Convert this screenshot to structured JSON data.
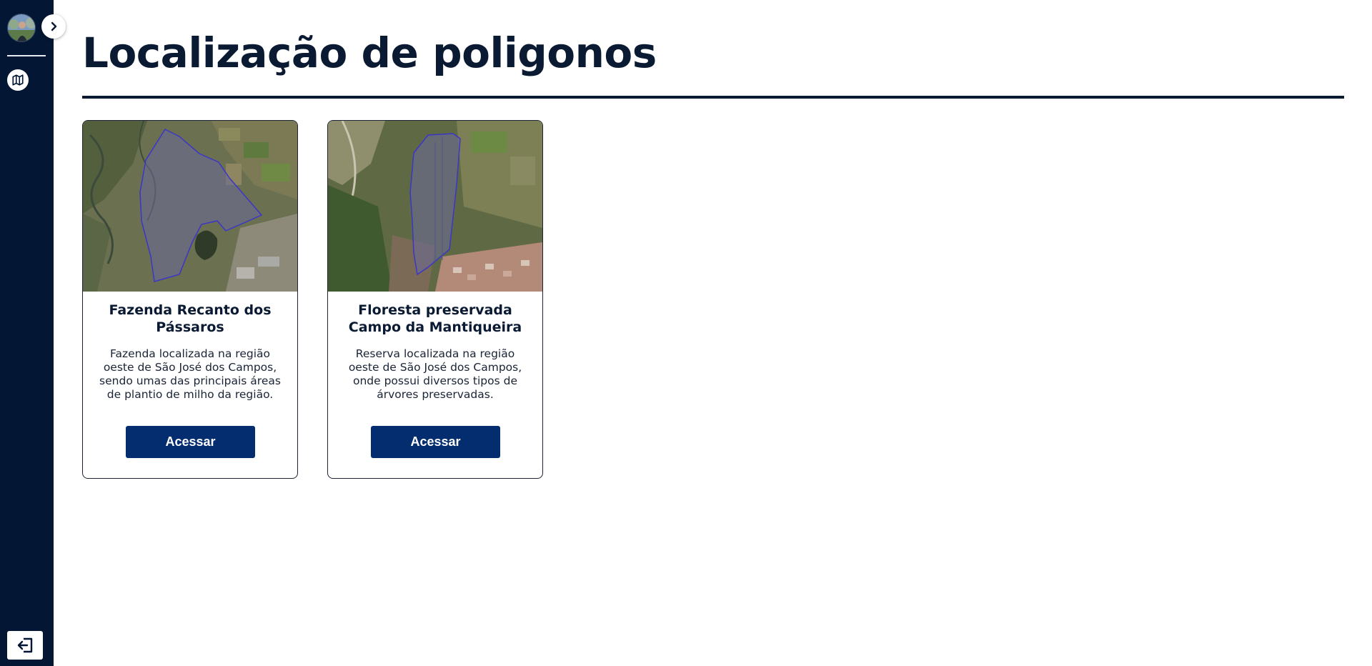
{
  "sidebar": {
    "icons": {
      "avatar": "user-avatar",
      "expand": "chevron-right-icon",
      "map": "map-icon",
      "logout": "logout-icon"
    }
  },
  "page": {
    "title": "Localização de poligonos"
  },
  "cards": [
    {
      "title": "Fazenda Recanto dos Pássaros",
      "description": "Fazenda localizada na região oeste de São José dos Campos, sendo umas das principais áreas de plantio de milho da região.",
      "button_label": "Acessar"
    },
    {
      "title": "Floresta preservada Campo da Mantiqueira",
      "description": "Reserva localizada na região oeste de São José dos Campos, onde possui diversos tipos de árvores preservadas.",
      "button_label": "Acessar"
    }
  ],
  "colors": {
    "sidebar_bg": "#031633",
    "title": "#0b1a33",
    "button_bg": "#032d6e",
    "polygon_stroke": "#3b35c9"
  }
}
